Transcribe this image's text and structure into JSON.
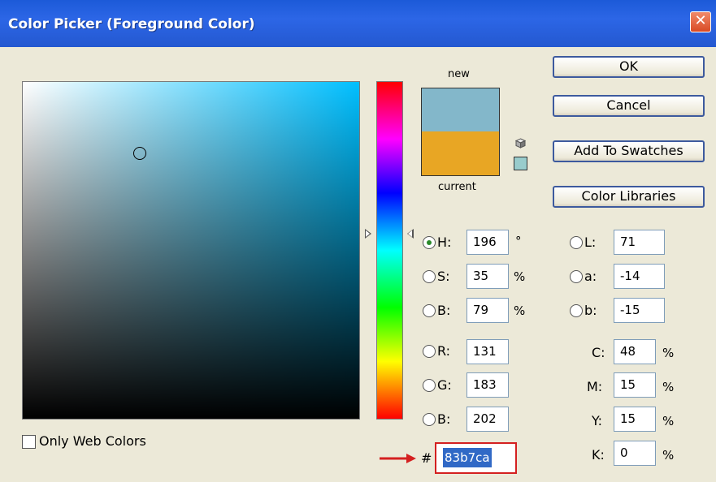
{
  "window": {
    "title": "Color Picker (Foreground Color)",
    "close_icon": "close-icon"
  },
  "colors": {
    "new": "#83b7ca",
    "current": "#e8a624",
    "accent_red": "#d42020"
  },
  "preview": {
    "new_label": "new",
    "current_label": "current"
  },
  "buttons": {
    "ok": "OK",
    "cancel": "Cancel",
    "add_to_swatches": "Add To Swatches",
    "color_libraries": "Color Libraries"
  },
  "hsb": {
    "h": {
      "label": "H:",
      "value": "196",
      "unit": "°"
    },
    "s": {
      "label": "S:",
      "value": "35",
      "unit": "%"
    },
    "b": {
      "label": "B:",
      "value": "79",
      "unit": "%"
    }
  },
  "rgb": {
    "r": {
      "label": "R:",
      "value": "131"
    },
    "g": {
      "label": "G:",
      "value": "183"
    },
    "b": {
      "label": "B:",
      "value": "202"
    }
  },
  "lab": {
    "l": {
      "label": "L:",
      "value": "71"
    },
    "a": {
      "label": "a:",
      "value": "-14"
    },
    "b": {
      "label": "b:",
      "value": "-15"
    }
  },
  "cmyk": {
    "c": {
      "label": "C:",
      "value": "48",
      "unit": "%"
    },
    "m": {
      "label": "M:",
      "value": "15",
      "unit": "%"
    },
    "y": {
      "label": "Y:",
      "value": "15",
      "unit": "%"
    },
    "k": {
      "label": "K:",
      "value": "0",
      "unit": "%"
    }
  },
  "hex": {
    "label": "#",
    "value": "83b7ca"
  },
  "only_web_colors": {
    "label": "Only Web Colors",
    "checked": false
  },
  "selected_mode": "H"
}
